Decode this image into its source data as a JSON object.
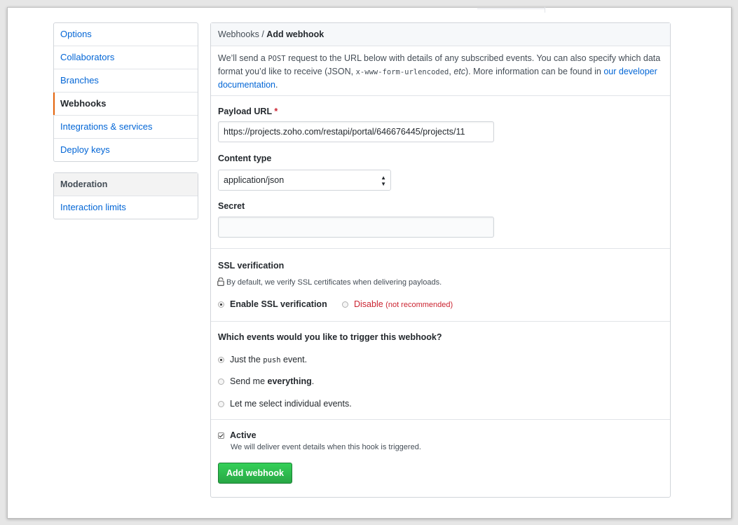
{
  "sidebar": {
    "items": [
      {
        "label": "Options"
      },
      {
        "label": "Collaborators"
      },
      {
        "label": "Branches"
      },
      {
        "label": "Webhooks"
      },
      {
        "label": "Integrations & services"
      },
      {
        "label": "Deploy keys"
      }
    ],
    "moderation_heading": "Moderation",
    "moderation_items": [
      {
        "label": "Interaction limits"
      }
    ]
  },
  "header": {
    "crumb": "Webhooks",
    "separator": "/",
    "title": "Add webhook"
  },
  "intro": {
    "t1": "We’ll send a ",
    "code1": "POST",
    "t2": " request to the URL below with details of any subscribed events. You can also specify which data format you’d like to receive (JSON, ",
    "code2": "x-www-form-urlencoded",
    "t3": ", ",
    "etc": "etc",
    "t4": "). More information can be found in ",
    "link": "our developer documentation",
    "t5": "."
  },
  "form": {
    "payload_url_label": "Payload URL",
    "required_mark": "*",
    "payload_url_value": "https://projects.zoho.com/restapi/portal/646676445/projects/11",
    "content_type_label": "Content type",
    "content_type_value": "application/json",
    "secret_label": "Secret",
    "secret_value": ""
  },
  "ssl": {
    "heading": "SSL verification",
    "note": "By default, we verify SSL certificates when delivering payloads.",
    "enable_label": "Enable SSL verification",
    "disable_label": "Disable",
    "disable_note": "(not recommended)"
  },
  "events": {
    "heading": "Which events would you like to trigger this webhook?",
    "opt1_pre": "Just the ",
    "opt1_code": "push",
    "opt1_post": " event.",
    "opt2_pre": "Send me ",
    "opt2_bold": "everything",
    "opt2_post": ".",
    "opt3": "Let me select individual events."
  },
  "active": {
    "label": "Active",
    "description": "We will deliver event details when this hook is triggered."
  },
  "submit_label": "Add webhook"
}
